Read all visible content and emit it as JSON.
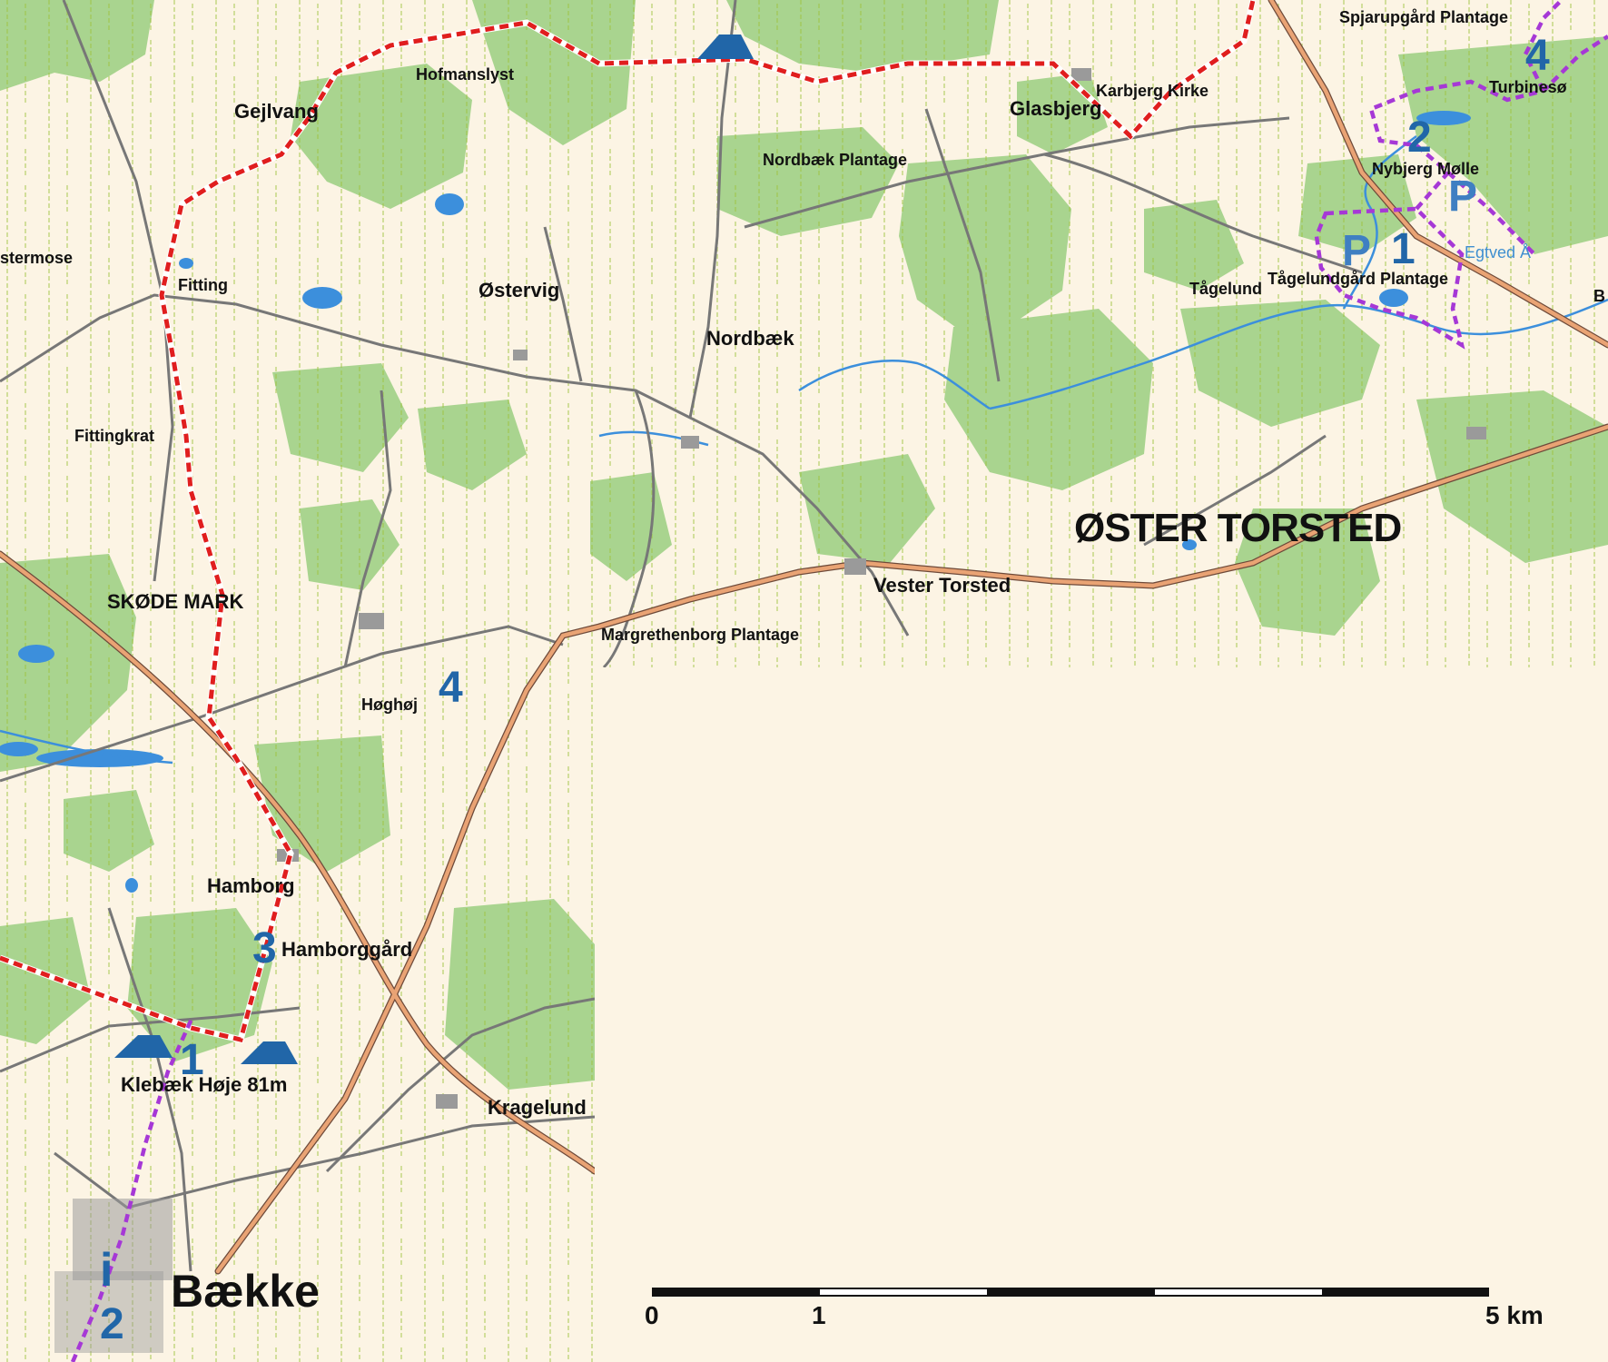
{
  "map": {
    "background_color": "#fcf4e4",
    "colors": {
      "forest": "#a9d48f",
      "field": "#fcf4e4",
      "road_main": "#e9a374",
      "road_minor": "#777777",
      "track": "#9dc13a",
      "water": "#3c8fdc",
      "route_red": "#e01e1e",
      "route_purple": "#a638d6",
      "marker_blue": "#2166a8"
    },
    "labels": {
      "spjarupgard": "Spjarupgård Plantage",
      "hofmanslyst": "Hofmanslyst",
      "gejlvang": "Gejlvang",
      "glasbjerg": "Glasbjerg",
      "karbjerg_kirke": "Karbjerg Kirke",
      "turbineso": "Turbinesø",
      "nordbaek_plantage": "Nordbæk Plantage",
      "nybjerg_molle": "Nybjerg Mølle",
      "stermose": "stermose",
      "fitting": "Fitting",
      "ostervig": "Østervig",
      "egtved": "Egtved Å",
      "tagelund": "Tågelund",
      "tagelundgard": "Tågelundgård Plantage",
      "b_edge": "B",
      "nordbaek": "Nordbæk",
      "fittingkrat": "Fittingkrat",
      "oster_torsted": "ØSTER TORSTED",
      "vester_torsted": "Vester Torsted",
      "skode_mark": "SKØDE MARK",
      "margrethenborg": "Margrethenborg Plantage",
      "hoghoj": "Høghøj",
      "hamborg": "Hamborg",
      "hamborggard": "Hamborggård",
      "klebaek": "Klebæk Høje 81m",
      "kragelund": "Kragelund",
      "baekke": "Bække"
    },
    "route_markers": {
      "m1_top": "1",
      "m2_top": "2",
      "m4_top": "4",
      "p_left": "P",
      "p_right": "P",
      "m4_hoghoj": "4",
      "m3": "3",
      "m1_bottom": "1",
      "m2_bottom": "2",
      "info": "i"
    },
    "icons": {
      "shelter": "shelter-tent-icon",
      "info": "info-icon",
      "parking": "parking-icon"
    },
    "scale_bar": {
      "label_start": "0",
      "label_mid": "1",
      "label_end": "5 km"
    }
  }
}
